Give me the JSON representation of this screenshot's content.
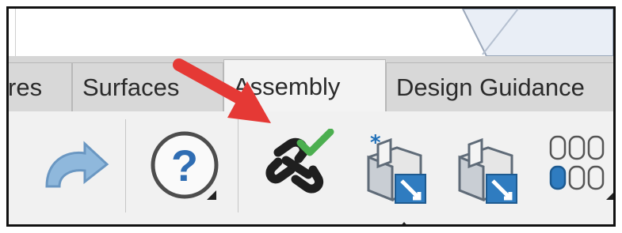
{
  "tabs": [
    {
      "label": "res"
    },
    {
      "label": "Surfaces"
    },
    {
      "label": "Assembly"
    },
    {
      "label": "Design Guidance"
    }
  ],
  "active_tab": "Assembly",
  "colors": {
    "callout_arrow": "#e53935",
    "check": "#4caf50",
    "frame_border": "#111111"
  },
  "icons": [
    "redo-icon",
    "help-icon",
    "link-check-icon",
    "new-assembly-icon",
    "insert-part-icon",
    "pattern-icon"
  ]
}
